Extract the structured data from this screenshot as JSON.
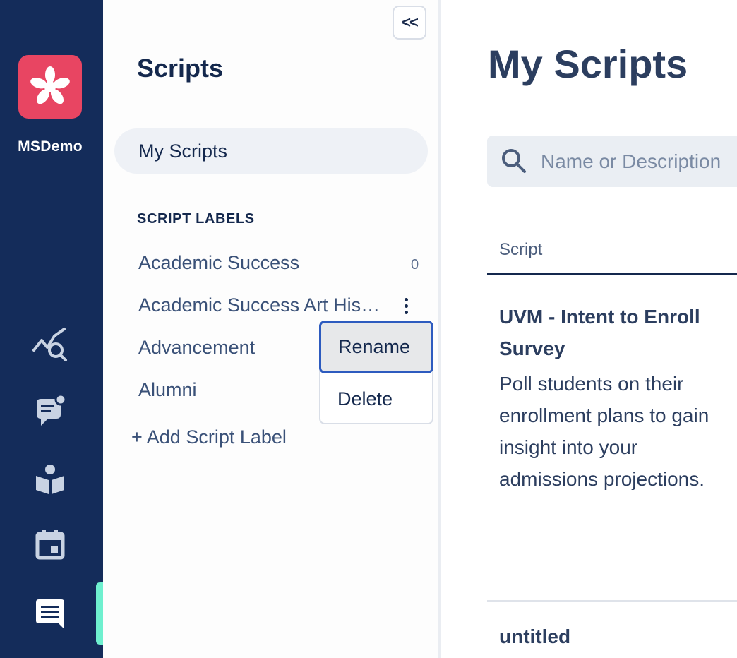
{
  "rail": {
    "org_name": "MSDemo",
    "logo_icon": "asterisk-logo",
    "icons": [
      "analytics-search-icon",
      "chat-bubble-icon",
      "reading-person-icon",
      "calendar-icon",
      "message-icon"
    ],
    "active": "message-icon",
    "accent": "#6ff0cf",
    "brand": "#e84562"
  },
  "sidebar": {
    "collapse_label": "<<",
    "title": "Scripts",
    "my_scripts": "My Scripts",
    "section_label": "SCRIPT LABELS",
    "labels": [
      {
        "name": "Academic Success",
        "count": "0"
      },
      {
        "name": "Academic Success Art His…",
        "count": ""
      },
      {
        "name": "Advancement",
        "count": ""
      },
      {
        "name": "Alumni",
        "count": ""
      }
    ],
    "add_label": "+ Add Script Label"
  },
  "context_menu": {
    "items": [
      "Rename",
      "Delete"
    ],
    "focused": "Rename"
  },
  "main": {
    "title": "My Scripts",
    "search": {
      "placeholder": "Name or Description",
      "value": ""
    },
    "columns": [
      "Script"
    ],
    "rows": [
      {
        "title": "UVM - Intent to Enroll Survey",
        "description": "Poll students on their enrollment plans to gain insight into your admissions projections."
      },
      {
        "title": "untitled",
        "description": ""
      }
    ]
  }
}
